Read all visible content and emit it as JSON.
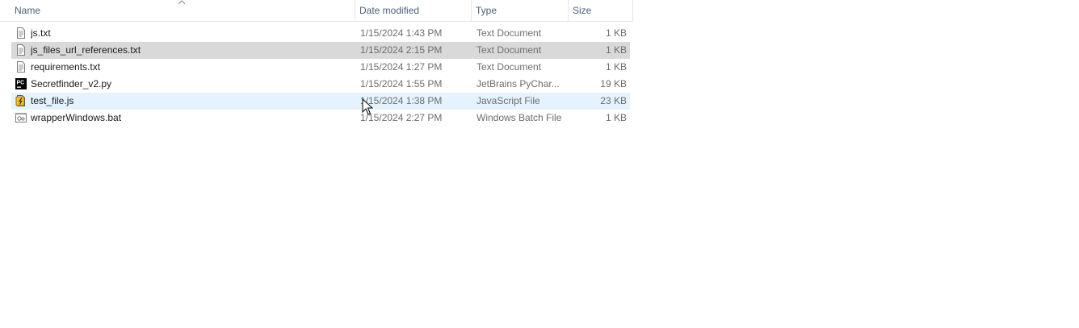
{
  "columns": {
    "name": "Name",
    "date": "Date modified",
    "type": "Type",
    "size": "Size"
  },
  "files": [
    {
      "name": "js.txt",
      "date": "1/15/2024 1:43 PM",
      "type": "Text Document",
      "size": "1 KB",
      "icon": "text-file-icon"
    },
    {
      "name": "js_files_url_references.txt",
      "date": "1/15/2024 2:15 PM",
      "type": "Text Document",
      "size": "1 KB",
      "icon": "text-file-icon"
    },
    {
      "name": "requirements.txt",
      "date": "1/15/2024 1:27 PM",
      "type": "Text Document",
      "size": "1 KB",
      "icon": "text-file-icon"
    },
    {
      "name": "Secretfinder_v2.py",
      "date": "1/15/2024 1:55 PM",
      "type": "JetBrains PyChar...",
      "size": "19 KB",
      "icon": "pycharm-file-icon"
    },
    {
      "name": "test_file.js",
      "date": "1/15/2024 1:38 PM",
      "type": "JavaScript File",
      "size": "23 KB",
      "icon": "javascript-file-icon"
    },
    {
      "name": "wrapperWindows.bat",
      "date": "1/15/2024 2:27 PM",
      "type": "Windows Batch File",
      "size": "1 KB",
      "icon": "batch-file-icon"
    }
  ]
}
